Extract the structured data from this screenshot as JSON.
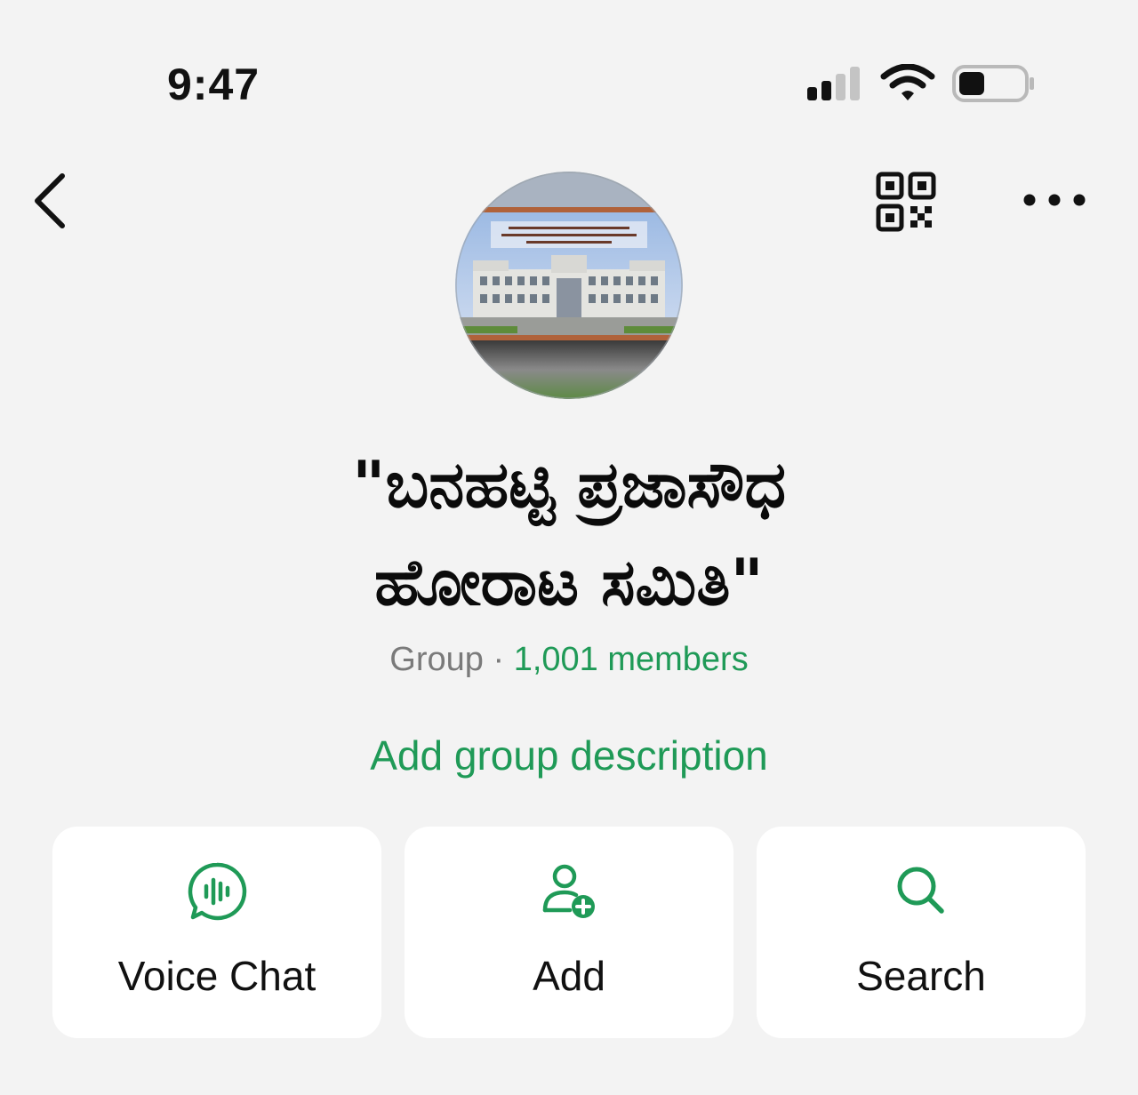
{
  "status_bar": {
    "time": "9:47",
    "signal_icon": "signal-bars-icon",
    "wifi_icon": "wifi-icon",
    "battery_icon": "battery-low-icon"
  },
  "nav": {
    "back_icon": "chevron-left-icon",
    "qr_icon": "qr-code-icon",
    "more_icon": "more-horizontal-icon"
  },
  "group": {
    "title_line1": "\"ಬನಹಟ್ಟಿ ಪ್ರಜಾಸೌಧ",
    "title_line2": "ಹೋರಾಟ ಸಮಿತಿ\"",
    "type_label": "Group",
    "separator": "·",
    "members_label": "1,001 members",
    "description_link": "Add group description"
  },
  "actions": [
    {
      "label": "Voice Chat",
      "icon": "voice-chat-icon"
    },
    {
      "label": "Add",
      "icon": "add-person-icon"
    },
    {
      "label": "Search",
      "icon": "search-icon"
    }
  ],
  "colors": {
    "accent": "#1f9a57",
    "background": "#f3f3f3",
    "card": "#ffffff",
    "muted_text": "#7a7a7a"
  }
}
